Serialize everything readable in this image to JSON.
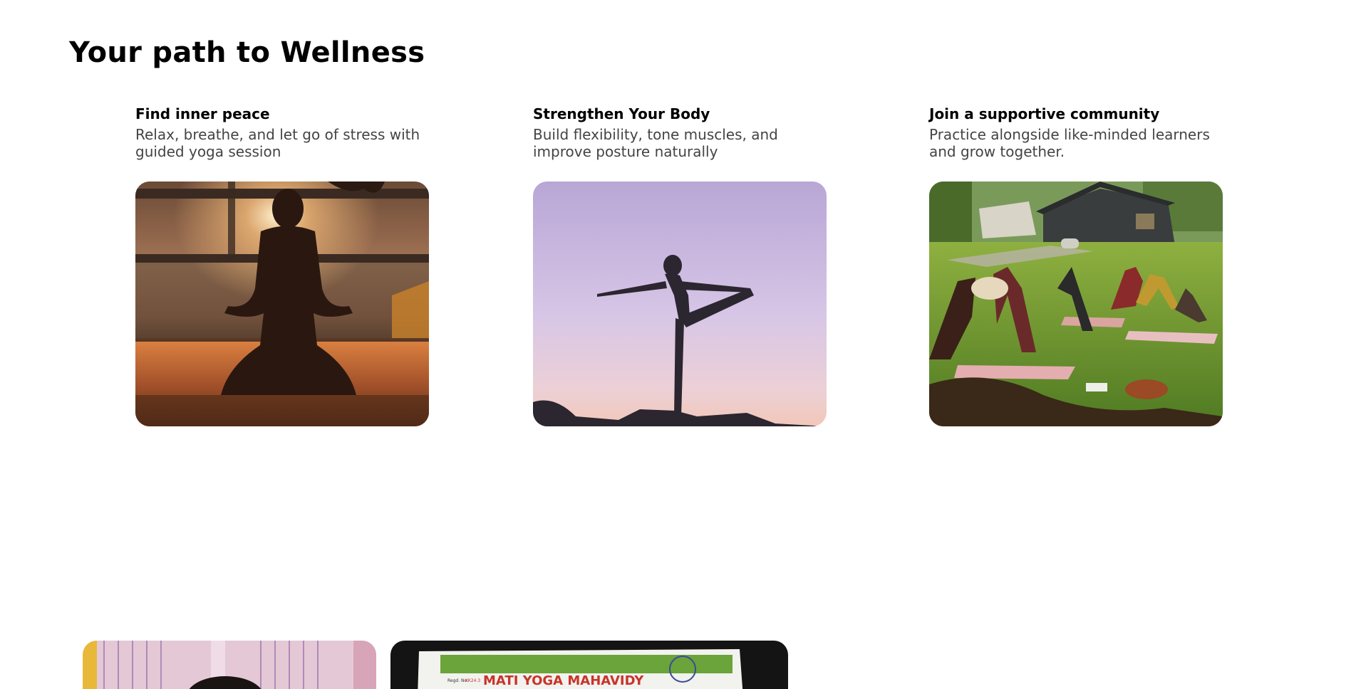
{
  "section": {
    "title": "Your path to Wellness"
  },
  "cards": [
    {
      "title": "Find inner peace",
      "description": "Relax, breathe, and let go of stress with guided yoga session",
      "image": "meditation-silhouette-sunset"
    },
    {
      "title": "Strengthen Your Body",
      "description": "Build flexibility, tone muscles, and improve posture naturally",
      "image": "standing-yoga-pose-silhouette"
    },
    {
      "title": "Join a supportive community",
      "description": "Practice alongside like-minded learners and grow together.",
      "image": "group-yoga-class-outdoors"
    }
  ],
  "bottom_images": [
    {
      "image": "person-portrait-curtains"
    },
    {
      "image": "yoga-certificate-photo",
      "text": "MATI YOGA MAHAVIDY",
      "regd_label": "Regd. No:",
      "regd_value": "KK24.3"
    }
  ],
  "colors": {
    "title": "#000000",
    "description": "#444444",
    "background": "#ffffff"
  }
}
